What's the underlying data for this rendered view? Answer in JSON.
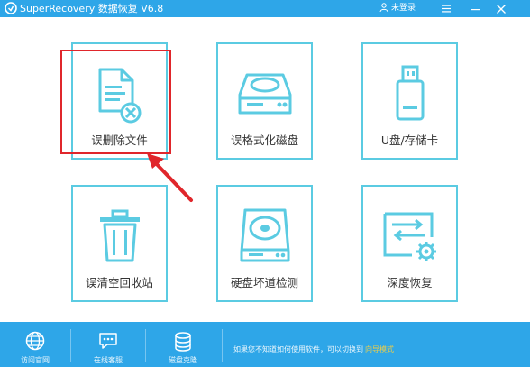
{
  "titlebar": {
    "app_name": "SuperRecovery 数据恢复 V6.8",
    "login_label": "未登录"
  },
  "tiles": [
    {
      "label": "误删除文件",
      "icon": "deleted-file-icon"
    },
    {
      "label": "误格式化磁盘",
      "icon": "disk-icon"
    },
    {
      "label": "U盘/存储卡",
      "icon": "usb-drive-icon"
    },
    {
      "label": "误清空回收站",
      "icon": "trash-icon"
    },
    {
      "label": "硬盘坏道检测",
      "icon": "disk-scan-icon"
    },
    {
      "label": "深度恢复",
      "icon": "deep-recovery-icon"
    }
  ],
  "bottombar": {
    "items": [
      {
        "label": "访问官网",
        "icon": "globe-icon"
      },
      {
        "label": "在线客服",
        "icon": "chat-icon"
      },
      {
        "label": "磁盘克隆",
        "icon": "database-icon"
      }
    ],
    "hint_text": "如果您不知道如何使用软件，可以切换到",
    "hint_link": "向导模式"
  },
  "colors": {
    "accent": "#2ea6e8",
    "tile_border": "#5bcbe2",
    "highlight": "#e0262b"
  }
}
